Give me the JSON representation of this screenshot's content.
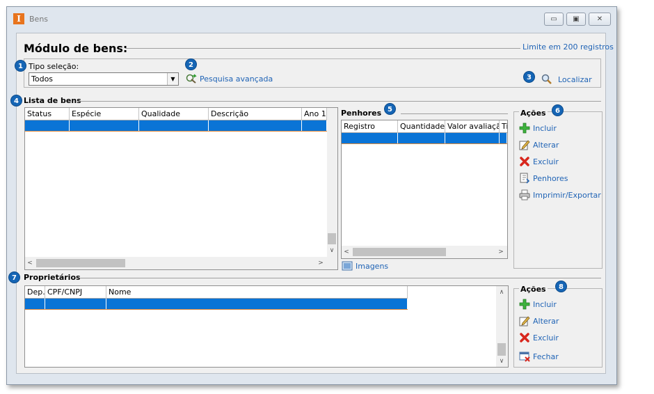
{
  "window": {
    "title": "Bens",
    "app_icon": "I",
    "controls": {
      "minimize": "▭",
      "maximize": "▣",
      "close": "✕"
    }
  },
  "header": {
    "title": "Módulo de bens:",
    "limit_link": "Limite em 200 registros"
  },
  "filter": {
    "label": "Tipo seleção:",
    "selected": "Todos",
    "advanced_search": "Pesquisa avançada",
    "locate": "Localizar"
  },
  "badges": [
    "1",
    "2",
    "3",
    "4",
    "5",
    "6",
    "7",
    "8"
  ],
  "bens": {
    "title": "Lista de bens",
    "columns": [
      "Status",
      "Espécie",
      "Qualidade",
      "Descrição",
      "Ano 1"
    ]
  },
  "penhores": {
    "title": "Penhores",
    "columns": [
      "Registro",
      "Quantidade",
      "Valor avaliação",
      "Ti"
    ],
    "images_link": "Imagens"
  },
  "acoes_bens": {
    "title": "Ações",
    "items": [
      "Incluir",
      "Alterar",
      "Excluir",
      "Penhores",
      "Imprimir/Exportar"
    ]
  },
  "proprietarios": {
    "title": "Proprietários",
    "columns": [
      "Dep.",
      "CPF/CNPJ",
      "Nome"
    ]
  },
  "acoes_proprietarios": {
    "title": "Ações",
    "items": [
      "Incluir",
      "Alterar",
      "Excluir",
      "Fechar"
    ]
  },
  "colors": {
    "accent_link": "#1f63b5",
    "badge": "#1565b5",
    "selection": "#0a74d6",
    "app_icon": "#e8741d"
  }
}
